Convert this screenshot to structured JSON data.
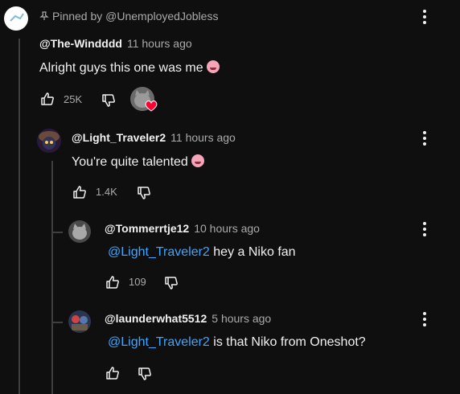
{
  "pinned_label": "Pinned by @UnemployedJobless",
  "comment": {
    "handle": "@The-Windddd",
    "time": "11 hours ago",
    "text": "Alright guys this one was me",
    "likes": "25K"
  },
  "replies": [
    {
      "handle": "@Light_Traveler2",
      "time": "11 hours ago",
      "mention": "",
      "text": "You're quite talented",
      "likes": "1.4K"
    },
    {
      "handle": "@Tommerrtje12",
      "time": "10 hours ago",
      "mention": "@Light_Traveler2",
      "text": " hey a Niko fan",
      "likes": "109"
    },
    {
      "handle": "@launderwhat5512",
      "time": "5 hours ago",
      "mention": "@Light_Traveler2",
      "text": " is that Niko from Oneshot?",
      "likes": ""
    }
  ],
  "colors": {
    "background": "#0f0f0f",
    "mention": "#3ea6ff",
    "heart": "#ff0033"
  }
}
